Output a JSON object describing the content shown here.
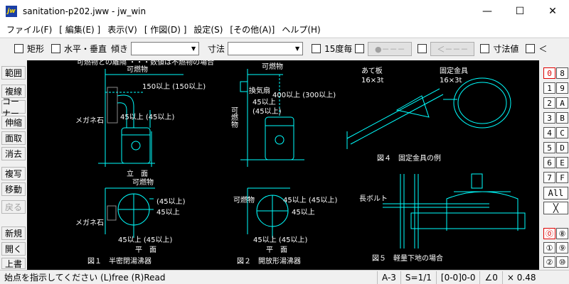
{
  "window": {
    "title": "sanitation-p202.jww - jw_win",
    "icon": "jw",
    "controls": {
      "minimize": "—",
      "maximize": "☐",
      "close": "✕"
    }
  },
  "menu": [
    "ファイル(F)",
    "[ 編集(E) ]",
    "表示(V)",
    "[ 作図(D) ]",
    "設定(S)",
    "[その他(A)]",
    "ヘルプ(H)"
  ],
  "toolbar": {
    "rect_label": "矩形",
    "hv_label": "水平・垂直",
    "slope_label": "傾き",
    "dim_label": "寸法",
    "deg15_label": "15度毎",
    "btn_circle": "●－－－",
    "btn_arrow": "＜－－－",
    "dimval_label": "寸法値",
    "lt_label": "＜"
  },
  "left_tools": [
    "範囲",
    "複線",
    "コーナー",
    "伸縮",
    "面取",
    "消去",
    "複写",
    "移動",
    "戻る",
    "新規",
    "開く",
    "上書"
  ],
  "right_tools": {
    "row1": [
      "0",
      "8"
    ],
    "row2": [
      "1",
      "9"
    ],
    "row3": [
      "2",
      "A"
    ],
    "row4": [
      "3",
      "B"
    ],
    "row5": [
      "4",
      "C"
    ],
    "row6": [
      "5",
      "D"
    ],
    "row7": [
      "6",
      "E"
    ],
    "row8": [
      "7",
      "F"
    ],
    "all": "All",
    "cross": "╳",
    "row9": [
      "⓪",
      "⑧"
    ],
    "row10": [
      "①",
      "⑨"
    ],
    "row11": [
      "②",
      "⑩"
    ]
  },
  "drawing": {
    "top_note": "可燃物との離隔 ・・・数値は不燃物の場合",
    "fig1": {
      "combustible_top": "可燃物",
      "dim1": "150以上 (150以上)",
      "meganeishi": "メガネ石",
      "dim2": "45以上 (45以上)",
      "elev": "立　面",
      "combustible_mid": "可燃物",
      "dim3": "(45以上)",
      "dim4": "45以上",
      "meganeishi2": "メガネ石",
      "dim5": "45以上 (45以上)",
      "plan": "平　面",
      "caption": "図１　半密閉湯沸器"
    },
    "fig2": {
      "combustible_top": "可燃物",
      "exhaust_fan": "換気扇",
      "dim1": "400以上 (300以上)",
      "dim2": "45以上",
      "dim3": "(45以上)",
      "side_label": "可燃物",
      "side_label2": "可燃物",
      "dim4": "45以上 (45以上)",
      "dim5": "45以上",
      "dim6": "45以上 (45以上)",
      "plan": "平　面",
      "caption": "図２　開放形湯沸器"
    },
    "fig4": {
      "plate": "あて板",
      "plate_size": "16×3t",
      "bracket": "固定金具",
      "bracket_size": "16×3t",
      "caption": "図４　固定金具の例"
    },
    "fig5": {
      "bolt": "長ボルト",
      "caption": "図５　軽量下地の場合"
    }
  },
  "status": {
    "message": "始点を指示してください (L)free (R)Read",
    "paper": "A-3",
    "scale": "S=1/1",
    "layer": "[0-0]0-0",
    "angle": "∠0",
    "zoom": "× 0.48"
  },
  "colors": {
    "canvas_bg": "#000000",
    "line_cyan": "#00ffff",
    "text_white": "#ffffff",
    "active_red": "#dd0000"
  }
}
